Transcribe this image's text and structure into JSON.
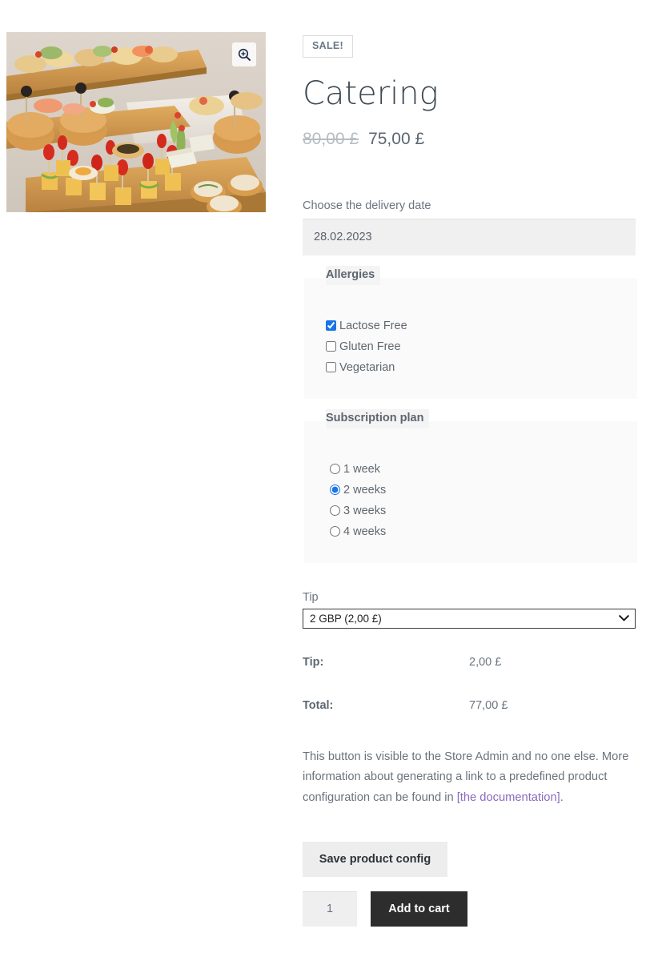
{
  "product": {
    "sale_badge": "SALE!",
    "title": "Catering",
    "price_old": "80,00 £",
    "price_new": "75,00 £",
    "image_alt": "catering-buffet-photo",
    "zoom_icon": "zoom-in-icon"
  },
  "delivery": {
    "label": "Choose the delivery date",
    "value": "28.02.2023",
    "placeholder": "DD.MM.YYYY"
  },
  "allergies": {
    "legend": "Allergies",
    "options": [
      {
        "label": "Lactose Free",
        "checked": true
      },
      {
        "label": "Gluten Free",
        "checked": false
      },
      {
        "label": "Vegetarian",
        "checked": false
      }
    ]
  },
  "subscription": {
    "legend": "Subscription plan",
    "options": [
      {
        "label": "1 week",
        "selected": false
      },
      {
        "label": "2 weeks",
        "selected": true
      },
      {
        "label": "3 weeks",
        "selected": false
      },
      {
        "label": "4 weeks",
        "selected": false
      }
    ]
  },
  "tip": {
    "label": "Tip",
    "selected": "2 GBP (2,00 £)",
    "chevron_icon": "chevron-down-icon"
  },
  "totals": {
    "tip_label": "Tip:",
    "tip_value": "2,00 £",
    "total_label": "Total:",
    "total_value": "77,00 £"
  },
  "admin_note": {
    "text_before": "This button is visible to the Store Admin and no one else. More information about generating a link to a predefined product configuration can be found in ",
    "link_text": "[the documentation]",
    "text_after": "."
  },
  "actions": {
    "save_label": "Save product config",
    "quantity": "1",
    "add_to_cart_label": "Add to cart"
  },
  "colors": {
    "accent_checkbox": "#1a73e8",
    "link": "#8b6bbd",
    "add_to_cart_bg": "#2d2d2d",
    "text": "#5f6871",
    "group_bg": "#fafafa"
  }
}
